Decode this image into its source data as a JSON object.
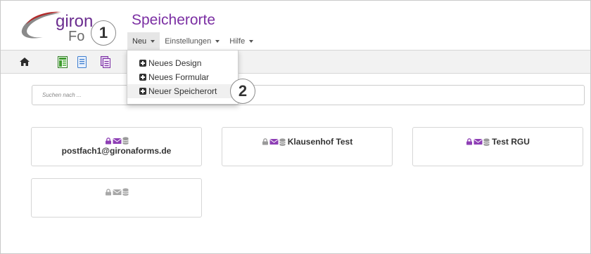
{
  "app": {
    "logo_line1": "giron",
    "logo_line2": "Fo",
    "page_title": "Speicherorte"
  },
  "menu": {
    "items": [
      {
        "label": "Neu",
        "active": true
      },
      {
        "label": "Einstellungen",
        "active": false
      },
      {
        "label": "Hilfe",
        "active": false
      }
    ]
  },
  "toolbar": {
    "buttons": [
      "home-icon",
      "spreadsheet-icon",
      "form-icon",
      "documents-icon"
    ]
  },
  "dropdown": {
    "items": [
      {
        "label": "Neues Design"
      },
      {
        "label": "Neues Formular"
      },
      {
        "label": "Neuer Speicherort"
      }
    ]
  },
  "search": {
    "placeholder": "Suchen nach ..."
  },
  "storage_locations": [
    {
      "label": "postfach1@gironaforms.de",
      "icons": [
        "lock-icon",
        "envelope-icon",
        "database-icon"
      ],
      "status": "active"
    },
    {
      "label": "Klausenhof Test",
      "icons": [
        "lock-icon",
        "envelope-icon",
        "database-icon"
      ],
      "status": "mixed"
    },
    {
      "label": "Test RGU",
      "icons": [
        "lock-icon",
        "envelope-icon",
        "database-icon"
      ],
      "status": "active"
    },
    {
      "label": "",
      "icons": [
        "lock-icon",
        "envelope-icon",
        "database-icon"
      ],
      "status": "inactive"
    }
  ],
  "callouts": [
    "1",
    "2"
  ],
  "colors": {
    "brand_purple": "#7b2fa3",
    "icon_purple": "#8e3fb5",
    "icon_gray": "#9a9a9a",
    "icon_green": "#3f9b2f",
    "icon_blue": "#3f7fd0"
  }
}
